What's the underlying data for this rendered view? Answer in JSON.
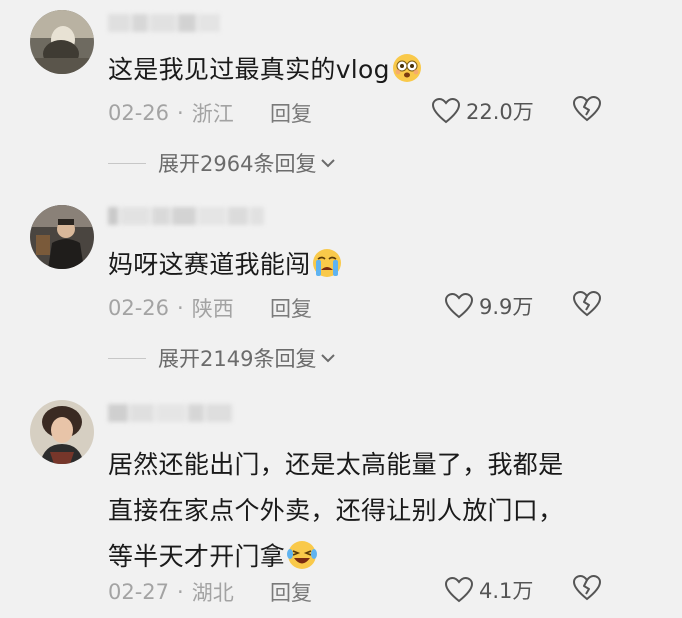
{
  "colors": {
    "background": "#f1f1f1",
    "text": "#1a1a1a",
    "meta": "#a3a3a3",
    "icon": "#555555"
  },
  "comments": [
    {
      "text_lines": [
        "这是我见过最真实的vlog"
      ],
      "emoji": "flushed-face",
      "date": "02-26",
      "location": "浙江",
      "reply_label": "回复",
      "likes": "22.0万",
      "expand_label": "展开2964条回复"
    },
    {
      "text_lines": [
        "妈呀这赛道我能闯"
      ],
      "emoji": "loudly-crying-face",
      "date": "02-26",
      "location": "陕西",
      "reply_label": "回复",
      "likes": "9.9万",
      "expand_label": "展开2149条回复"
    },
    {
      "text_lines": [
        "居然还能出门，还是太高能量了，我都是",
        "直接在家点个外卖，还得让别人放门口，",
        "等半天才开门拿"
      ],
      "emoji": "laughing-tears-face",
      "date": "02-27",
      "location": "湖北",
      "reply_label": "回复",
      "likes": "4.1万"
    }
  ],
  "separator": "·"
}
